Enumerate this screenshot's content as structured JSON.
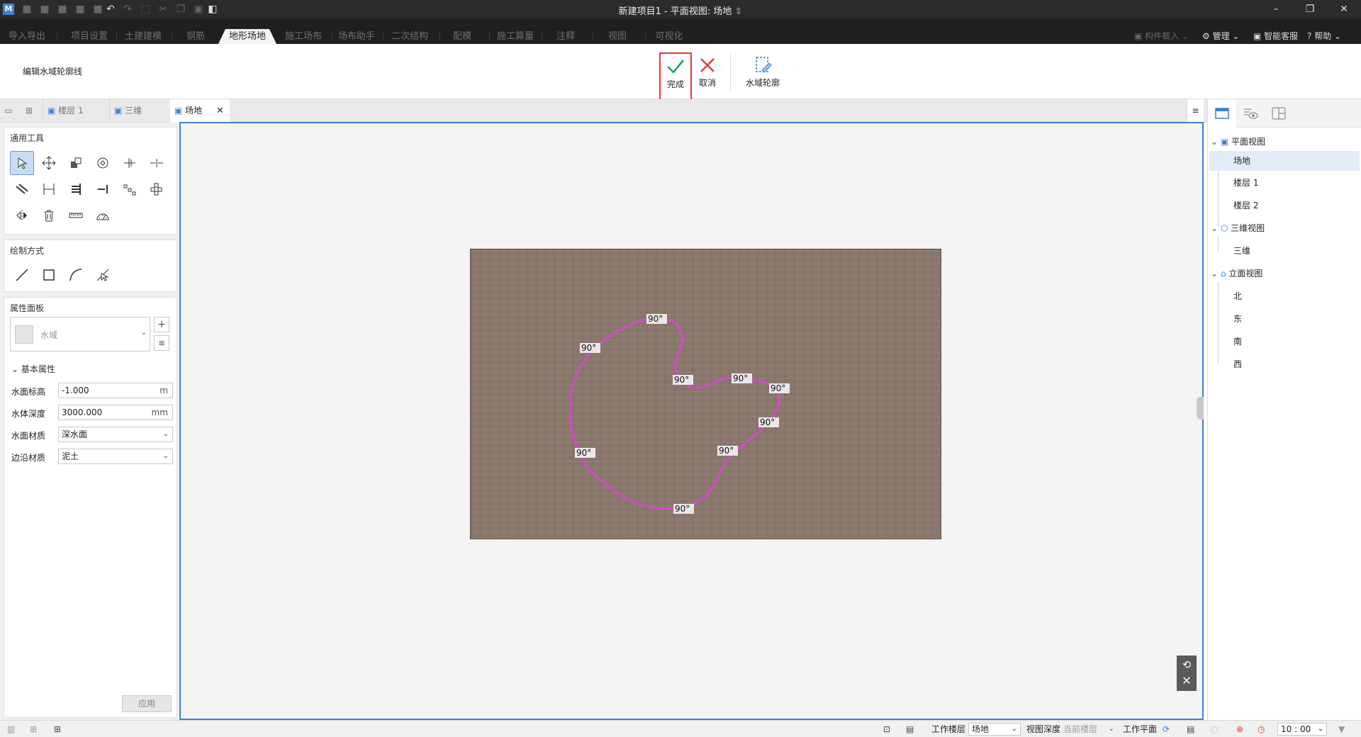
{
  "window": {
    "title": "新建项目1 - 平面视图: 场地",
    "title_arrow": "⇕",
    "app_icon": "M"
  },
  "menu_tabs": [
    {
      "label": "导入导出"
    },
    {
      "label": "项目设置"
    },
    {
      "label": "土建建模"
    },
    {
      "label": "钢筋"
    },
    {
      "label": "地形场地",
      "active": true
    },
    {
      "label": "施工场布"
    },
    {
      "label": "场布助手"
    },
    {
      "label": "二次结构"
    },
    {
      "label": "配模"
    },
    {
      "label": "施工算量"
    },
    {
      "label": "注释"
    },
    {
      "label": "视图"
    },
    {
      "label": "可视化"
    }
  ],
  "menu_right": {
    "component_load": "构件载入",
    "manage": "管理",
    "smart_service": "智能客服",
    "help": "帮助"
  },
  "ribbon": {
    "mode_label": "编辑水域轮廓线",
    "done": "完成",
    "cancel": "取消",
    "water_outline": "水域轮廓"
  },
  "doc_tabs": [
    {
      "label": "楼层 1"
    },
    {
      "label": "三维"
    },
    {
      "label": "场地",
      "active": true
    }
  ],
  "left_panel": {
    "general_tools_title": "通用工具",
    "draw_mode_title": "绘制方式",
    "properties_title": "属性面板",
    "type_selector": "水域",
    "basic_props_title": "基本属性",
    "props": {
      "water_level": {
        "label": "水面标高",
        "value": "-1.000",
        "unit": "m"
      },
      "water_depth": {
        "label": "水体深度",
        "value": "3000.000",
        "unit": "mm"
      },
      "surface_material": {
        "label": "水面材质",
        "value": "深水面"
      },
      "edge_material": {
        "label": "边沿材质",
        "value": "泥土"
      }
    },
    "apply_button": "应用"
  },
  "canvas": {
    "angle_labels": [
      "90°",
      "90°",
      "90°",
      "90°",
      "90°",
      "90°",
      "90°",
      "90°",
      "90°"
    ],
    "outline_color": "#e040e0",
    "terrain_color": "#8a776b"
  },
  "right_panel": {
    "tree": {
      "plan_views": "平面视图",
      "site": "场地",
      "floor1": "楼层 1",
      "floor2": "楼层 2",
      "three_d_views": "三维视图",
      "three_d": "三维",
      "elevation_views": "立面视图",
      "north": "北",
      "east": "东",
      "south": "南",
      "west": "西"
    }
  },
  "status_bar": {
    "work_floor_label": "工作楼层",
    "work_floor_value": "场地",
    "view_depth_label": "视图深度",
    "view_depth_value": "当前楼层",
    "work_plane_label": "工作平面",
    "scale_value": "10 : 00"
  },
  "colors": {
    "accent": "#3d7fd6",
    "done_highlight": "#e53935",
    "check_green": "#1aa260",
    "cancel_red": "#e53935"
  }
}
